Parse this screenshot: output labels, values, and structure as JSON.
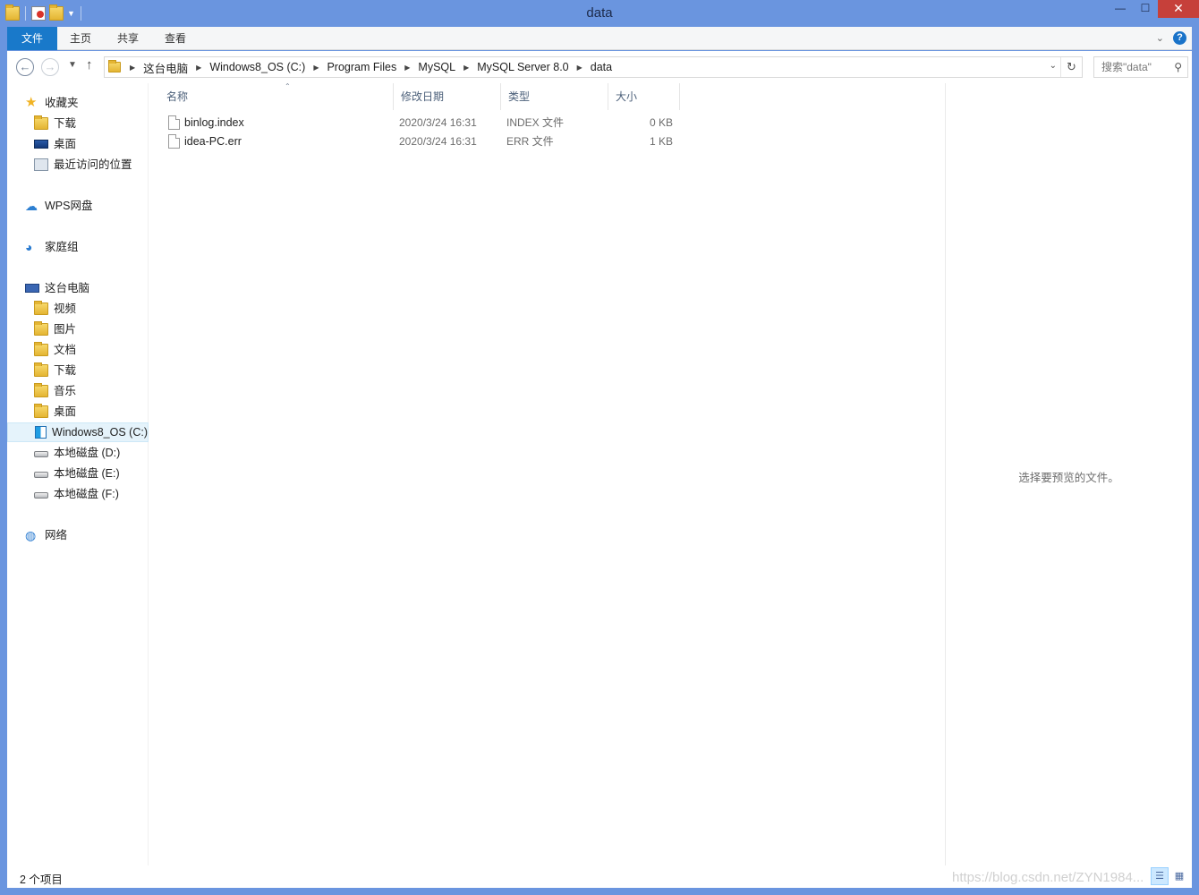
{
  "window": {
    "title": "data"
  },
  "title_bar": {
    "minimize": "—",
    "maximize": "☐",
    "close": "✕"
  },
  "ribbon": {
    "tabs": [
      {
        "label": "文件"
      },
      {
        "label": "主页"
      },
      {
        "label": "共享"
      },
      {
        "label": "查看"
      }
    ],
    "help": "?"
  },
  "address": {
    "crumbs": [
      "这台电脑",
      "Windows8_OS (C:)",
      "Program Files",
      "MySQL",
      "MySQL Server 8.0",
      "data"
    ]
  },
  "search": {
    "placeholder": "搜索\"data\""
  },
  "nav": {
    "favorites": {
      "label": "收藏夹",
      "items": [
        "下载",
        "桌面",
        "最近访问的位置"
      ]
    },
    "wps": "WPS网盘",
    "homegroup": "家庭组",
    "this_pc": {
      "label": "这台电脑",
      "items": [
        "视频",
        "图片",
        "文档",
        "下载",
        "音乐",
        "桌面"
      ],
      "drives": [
        "Windows8_OS (C:)",
        "本地磁盘 (D:)",
        "本地磁盘 (E:)",
        "本地磁盘 (F:)"
      ]
    },
    "network": "网络"
  },
  "columns": [
    "名称",
    "修改日期",
    "类型",
    "大小"
  ],
  "files": [
    {
      "name": "binlog.index",
      "modified": "2020/3/24 16:31",
      "type": "INDEX 文件",
      "size": "0 KB"
    },
    {
      "name": "idea-PC.err",
      "modified": "2020/3/24 16:31",
      "type": "ERR 文件",
      "size": "1 KB"
    }
  ],
  "preview": {
    "message": "选择要预览的文件。"
  },
  "status": {
    "item_count": "2 个项目"
  },
  "watermark": "https://blog.csdn.net/ZYN1984..."
}
